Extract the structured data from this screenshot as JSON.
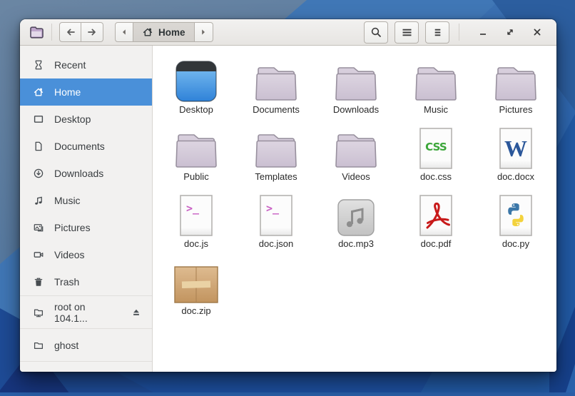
{
  "colors": {
    "accent": "#4a90d9",
    "titlebar_bg": "#efedeb",
    "sidebar_bg": "#f2f1f0",
    "content_bg": "#ffffff",
    "folder_fill": "#d3c9d9",
    "css_badge_color": "#3ba639",
    "word_badge_color": "#2b579a",
    "script_badge_color": "#c85fc3",
    "pdf_mark_color": "#c81a1a",
    "zip_fill": "#ceA06b"
  },
  "titlebar": {
    "app_icon": "files-app-icon",
    "nav": {
      "back_icon": "arrow-left-icon",
      "forward_icon": "arrow-right-icon"
    },
    "pathbar": {
      "prev_icon": "chevron-left-icon",
      "current_icon": "home-icon",
      "current_label": "Home",
      "next_icon": "chevron-right-icon"
    },
    "actions": [
      {
        "name": "search",
        "icon": "search-icon"
      },
      {
        "name": "list-view",
        "icon": "list-view-icon"
      },
      {
        "name": "menu",
        "icon": "hamburger-menu-icon"
      }
    ],
    "window_controls": [
      {
        "name": "minimize",
        "icon": "minimize-icon"
      },
      {
        "name": "maximize",
        "icon": "maximize-icon"
      },
      {
        "name": "close",
        "icon": "close-icon"
      }
    ]
  },
  "sidebar": {
    "items": [
      {
        "label": "Recent",
        "icon": "recent-icon",
        "selected": false
      },
      {
        "label": "Home",
        "icon": "home-icon",
        "selected": true
      },
      {
        "label": "Desktop",
        "icon": "desktop-icon",
        "selected": false
      },
      {
        "label": "Documents",
        "icon": "document-icon",
        "selected": false
      },
      {
        "label": "Downloads",
        "icon": "download-icon",
        "selected": false
      },
      {
        "label": "Music",
        "icon": "music-icon",
        "selected": false
      },
      {
        "label": "Pictures",
        "icon": "pictures-icon",
        "selected": false
      },
      {
        "label": "Videos",
        "icon": "videos-icon",
        "selected": false
      },
      {
        "label": "Trash",
        "icon": "trash-icon",
        "selected": false
      }
    ],
    "mounts": [
      {
        "label": "root on 104.1...",
        "icon": "network-folder-icon",
        "eject_icon": "eject-icon"
      }
    ],
    "bookmarks": [
      {
        "label": "ghost",
        "icon": "folder-icon"
      }
    ]
  },
  "files": [
    {
      "name": "Desktop",
      "type": "desktop-folder"
    },
    {
      "name": "Documents",
      "type": "folder"
    },
    {
      "name": "Downloads",
      "type": "folder"
    },
    {
      "name": "Music",
      "type": "folder"
    },
    {
      "name": "Pictures",
      "type": "folder"
    },
    {
      "name": "Public",
      "type": "folder"
    },
    {
      "name": "Templates",
      "type": "folder"
    },
    {
      "name": "Videos",
      "type": "folder"
    },
    {
      "name": "doc.css",
      "type": "css-file",
      "badge": "CSS"
    },
    {
      "name": "doc.docx",
      "type": "word-file",
      "badge": "W"
    },
    {
      "name": "doc.js",
      "type": "script-file",
      "badge": ">_"
    },
    {
      "name": "doc.json",
      "type": "script-file",
      "badge": ">_"
    },
    {
      "name": "doc.mp3",
      "type": "audio-file"
    },
    {
      "name": "doc.pdf",
      "type": "pdf-file"
    },
    {
      "name": "doc.py",
      "type": "python-file"
    },
    {
      "name": "doc.zip",
      "type": "archive-file"
    }
  ]
}
